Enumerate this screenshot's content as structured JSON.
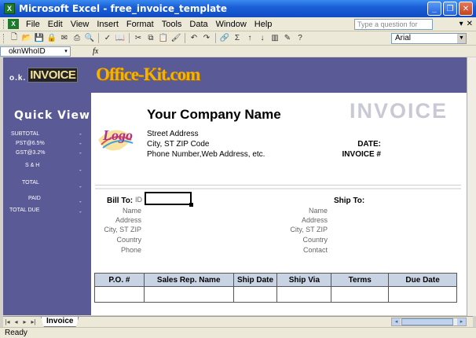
{
  "window": {
    "title": "Microsoft Excel - free_invoice_template",
    "app_icon": "X",
    "minimize": "_",
    "restore": "❐",
    "close": "✕"
  },
  "menu": {
    "items": [
      "File",
      "Edit",
      "View",
      "Insert",
      "Format",
      "Tools",
      "Data",
      "Window",
      "Help"
    ],
    "help_placeholder": "Type a question for help",
    "help_dropdown": "▾",
    "doc_close": "✕"
  },
  "toolbar": {
    "font_name": "Arial",
    "icons": [
      "new-icon",
      "open-icon",
      "save-icon",
      "permission-icon",
      "email-icon",
      "print-icon",
      "print-preview-icon",
      "spelling-icon",
      "research-icon",
      "cut-icon",
      "copy-icon",
      "paste-icon",
      "format-painter-icon",
      "undo-icon",
      "redo-icon",
      "hyperlink-icon",
      "autosum-icon",
      "sort-asc-icon",
      "sort-desc-icon",
      "chart-wizard-icon",
      "drawing-icon",
      "help-icon"
    ]
  },
  "formula_bar": {
    "name_box": "oknWhoID",
    "fx": "fx",
    "dropdown": "▾"
  },
  "header_band": {
    "brand_prefix": "o.k.",
    "brand_invoice": "INVOICE",
    "site_name": "Office-Kit.com"
  },
  "sidebar": {
    "title": "Quick View",
    "rows": [
      {
        "label": "SUBTOTAL",
        "value": "-"
      },
      {
        "label": "PST@6.5%",
        "value": "-"
      },
      {
        "label": "GST@3.2%",
        "value": "-"
      },
      {
        "label": "S & H",
        "value": "-"
      },
      {
        "label": "TOTAL",
        "value": "-"
      },
      {
        "label": "PAID",
        "value": "-"
      },
      {
        "label": "TOTAL DUE",
        "value": "-"
      }
    ]
  },
  "invoice": {
    "logo_text": "Logo",
    "company_name": "Your Company Name",
    "street": "Street Address",
    "city": "City, ST  ZIP Code",
    "contact": "Phone Number,Web Address, etc.",
    "title": "INVOICE",
    "date_label": "DATE:",
    "number_label": "INVOICE #"
  },
  "bill_to": {
    "heading": "Bill To:",
    "id_label": "ID",
    "fields": [
      "Name",
      "Address",
      "City, ST ZIP",
      "Country",
      "Phone"
    ]
  },
  "ship_to": {
    "heading": "Ship To:",
    "fields": [
      "Name",
      "Address",
      "City, ST ZIP",
      "Country",
      "Contact"
    ]
  },
  "po_table": {
    "columns": [
      "P.O. #",
      "Sales Rep. Name",
      "Ship Date",
      "Ship Via",
      "Terms",
      "Due Date"
    ]
  },
  "sheet_tabs": {
    "nav": [
      "|◂",
      "◂",
      "▸",
      "▸|"
    ],
    "active": "Invoice",
    "scroll_left": "◂",
    "scroll_right": "▸"
  },
  "status": {
    "text": "Ready"
  },
  "colors": {
    "titlebar": "#1c5fd7",
    "band": "#5a5a96",
    "table_header": "#c8d4e4",
    "site_name": "#f5b300"
  }
}
